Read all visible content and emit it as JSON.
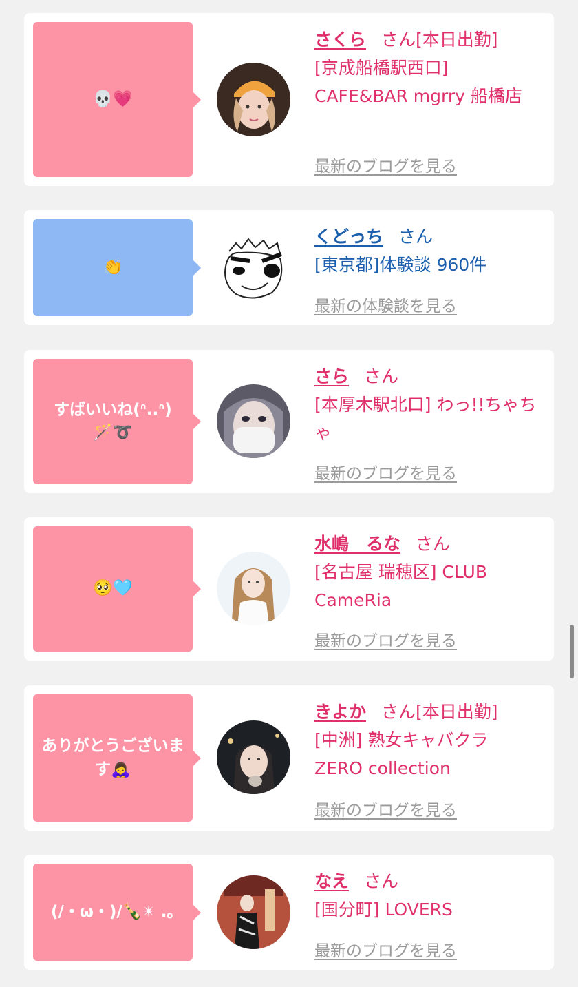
{
  "more_blog_label": "最新のブログを見る",
  "more_review_label": "最新の体験談を見る",
  "honorific": "さん",
  "colors": {
    "pink_bubble": "#fd94a6",
    "blue_bubble": "#8db8f4",
    "pink_text": "#e0306b",
    "blue_text": "#1b5fae",
    "link_gray": "#9a9a9a"
  },
  "items": [
    {
      "message": "💀💗",
      "name": "さくら",
      "status": "[本日出勤]",
      "desc": "[京成船橋駅西口] CAFE&BAR mgrry 船橋店",
      "link": "最新のブログを見る",
      "avatar_icon": "woman-orange-cap-avatar"
    },
    {
      "message": "👏",
      "name": "くどっち",
      "status": "",
      "desc": "[東京都]体験談 960件",
      "link": "最新の体験談を見る",
      "avatar_icon": "drawn-face-avatar"
    },
    {
      "message": "すばいいね(ᐢ..ᐢ)\n🪄➰",
      "name": "さら",
      "status": "",
      "desc": "[本厚木駅北口] わっ!!ちゃちゃ",
      "link": "最新のブログを見る",
      "avatar_icon": "woman-mask-avatar"
    },
    {
      "message": "🥺🩵",
      "name": "水嶋　るな",
      "status": "",
      "desc": "[名古屋 瑞穂区] CLUB CameRia",
      "link": "最新のブログを見る",
      "avatar_icon": "woman-light-avatar"
    },
    {
      "message": "ありがとうございます🙇‍♀️",
      "name": "きよか",
      "status": "[本日出勤]",
      "desc": "[中洲] 熟女キャバクラ ZERO collection",
      "link": "最新のブログを見る",
      "avatar_icon": "woman-night-avatar"
    },
    {
      "message": "(/・ω・)/🍾✴︎ .｡",
      "name": "なえ",
      "status": "",
      "desc": "[国分町] LOVERS",
      "link": "最新のブログを見る",
      "avatar_icon": "woman-kimono-avatar"
    }
  ]
}
